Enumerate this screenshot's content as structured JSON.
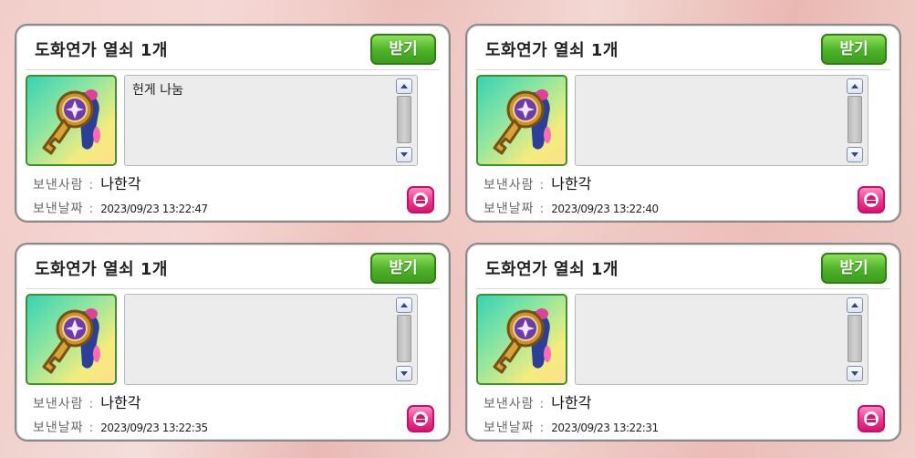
{
  "labels": {
    "sender": "보낸사람",
    "date": "보낸날짜",
    "separator": ":"
  },
  "cards": [
    {
      "title": "도화연가 열쇠 1개",
      "receive_label": "받기",
      "message": "헌게 나눔",
      "sender": "나한각",
      "date": "2023/09/23 13:22:47",
      "icon": "golden-key-icon"
    },
    {
      "title": "도화연가 열쇠 1개",
      "receive_label": "받기",
      "message": "",
      "sender": "나한각",
      "date": "2023/09/23 13:22:40",
      "icon": "golden-key-icon"
    },
    {
      "title": "도화연가 열쇠 1개",
      "receive_label": "받기",
      "message": "",
      "sender": "나한각",
      "date": "2023/09/23 13:22:35",
      "icon": "golden-key-icon"
    },
    {
      "title": "도화연가 열쇠 1개",
      "receive_label": "받기",
      "message": "",
      "sender": "나한각",
      "date": "2023/09/23 13:22:31",
      "icon": "golden-key-icon"
    }
  ],
  "colors": {
    "receive_button": "#4fb52a",
    "delete_button": "#f03c92",
    "item_frame": "#3f8f2f"
  }
}
